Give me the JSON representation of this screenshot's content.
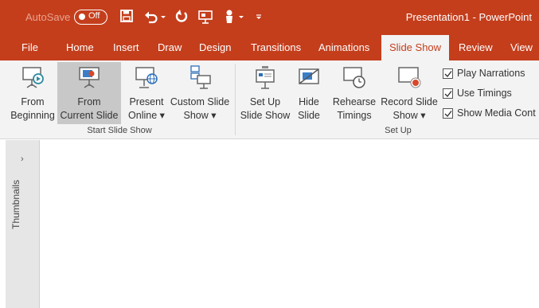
{
  "titlebar": {
    "autosave_label": "AutoSave",
    "autosave_state": "Off",
    "title": "Presentation1  -  PowerPoint",
    "quick_access_icons": [
      "save-icon",
      "undo-icon",
      "undo-dropdown-icon",
      "redo-icon",
      "present-icon",
      "touch-mode-icon",
      "touch-dropdown-icon",
      "customize-icon"
    ]
  },
  "tabs": [
    "File",
    "Home",
    "Insert",
    "Draw",
    "Design",
    "Transitions",
    "Animations",
    "Slide Show",
    "Review",
    "View"
  ],
  "active_tab": "Slide Show",
  "ribbon": {
    "start_group": {
      "label": "Start Slide Show",
      "from_beginning": [
        "From",
        "Beginning"
      ],
      "from_current": [
        "From",
        "Current Slide"
      ],
      "present_online": [
        "Present",
        "Online ▾"
      ],
      "custom_show": [
        "Custom Slide",
        "Show ▾"
      ]
    },
    "setup_group": {
      "label": "Set Up",
      "setup_show": [
        "Set Up",
        "Slide Show"
      ],
      "hide_slide": [
        "Hide",
        "Slide"
      ],
      "rehearse": [
        "Rehearse",
        "Timings"
      ],
      "record": [
        "Record Slide",
        "Show ▾"
      ],
      "checkboxes": [
        {
          "label": "Play Narrations",
          "checked": true
        },
        {
          "label": "Use Timings",
          "checked": true
        },
        {
          "label": "Show Media Cont",
          "checked": true
        }
      ]
    }
  },
  "left_panel": {
    "label": "Thumbnails",
    "expand_glyph": "›"
  },
  "colors": {
    "accent": "#c43e1c",
    "ribbon_bg": "#f3f3f3",
    "selected_btn": "#c8c8c8"
  }
}
